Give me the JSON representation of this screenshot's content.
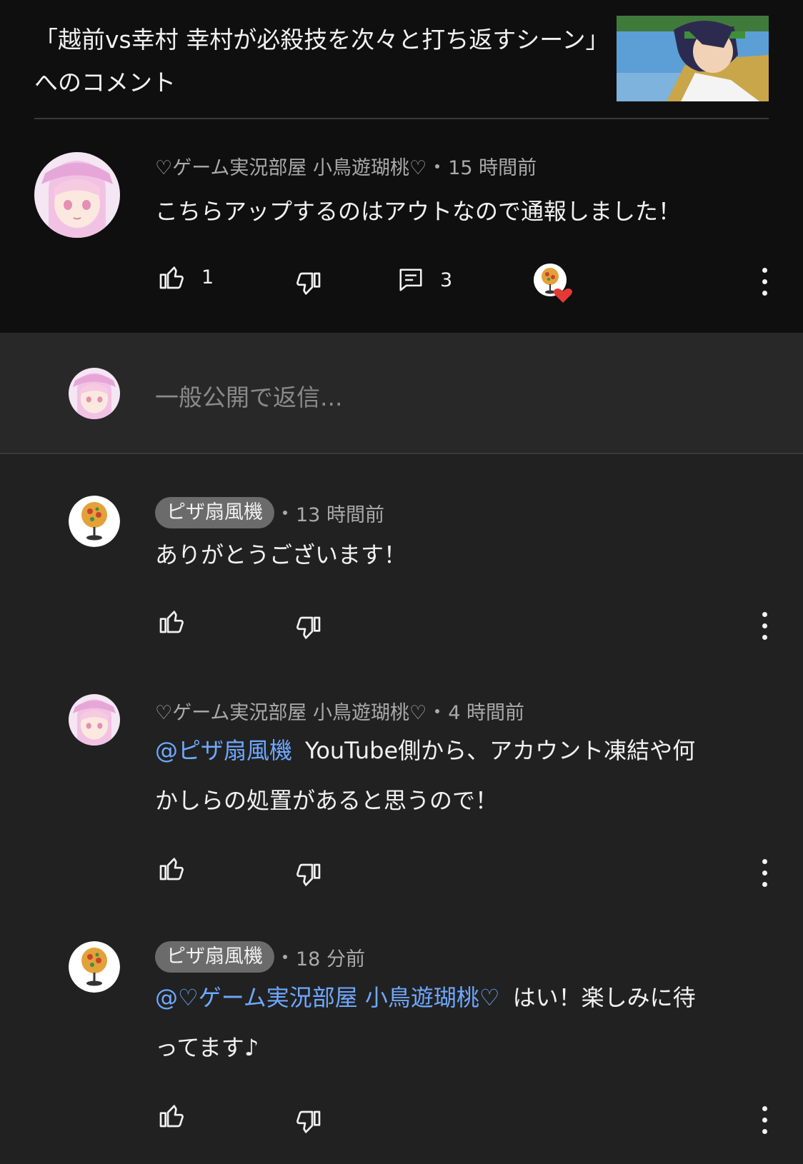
{
  "header": {
    "title": "「越前vs幸村 幸村が必殺技を次々と打ち返すシーン」へのコメント"
  },
  "main_comment": {
    "author": "♡ゲーム実況部屋 小鳥遊瑚桃♡",
    "time": "15 時間前",
    "text": "こちらアップするのはアウトなので通報しました！",
    "likes": "1",
    "replies": "3"
  },
  "reply_box": {
    "placeholder": "一般公開で返信..."
  },
  "replies": [
    {
      "author": "ピザ扇風機",
      "time": "13 時間前",
      "text": "ありがとうございます！"
    },
    {
      "author": "♡ゲーム実況部屋 小鳥遊瑚桃♡",
      "time": "4 時間前",
      "mention": "@ピザ扇風機",
      "text_line1": "YouTube側から、アカウント凍結や何",
      "text_line2": "かしらの処置があると思うので！"
    },
    {
      "author": "ピザ扇風機",
      "time": "18 分前",
      "mention": "@♡ゲーム実況部屋 小鳥遊瑚桃♡",
      "text_line1": "はい！楽しみに待",
      "text_line2": "ってます♪"
    }
  ],
  "colors": {
    "background": "#212121",
    "header_background": "#0f0f0f",
    "mention": "#6ea8fe",
    "chip": "#6b6b6b",
    "heart": "#e53935"
  },
  "icons": {
    "like": "thumbs-up-icon",
    "dislike": "thumbs-down-icon",
    "reply": "comment-icon",
    "more": "more-vert-icon",
    "creator_heart": "creator-heart-icon"
  }
}
